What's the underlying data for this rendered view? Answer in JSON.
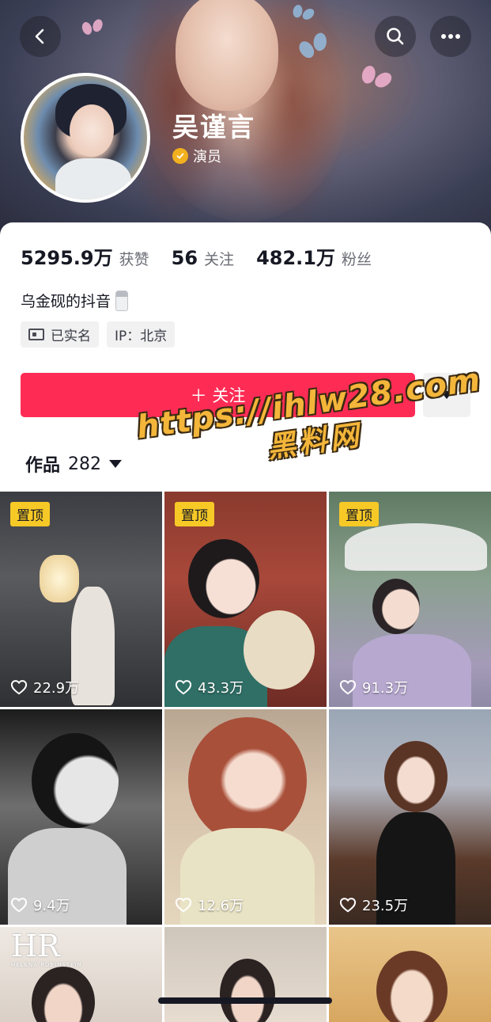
{
  "profile": {
    "name": "吴谨言",
    "role": "演员",
    "bio": "乌金砚的抖音",
    "tags": [
      "已实名",
      "IP：北京"
    ]
  },
  "stats": [
    {
      "value": "5295.9万",
      "label": "获赞"
    },
    {
      "value": "56",
      "label": "关注"
    },
    {
      "value": "482.1万",
      "label": "粉丝"
    }
  ],
  "actions": {
    "follow_label": "＋ 关注"
  },
  "works": {
    "label": "作品",
    "count": "282"
  },
  "watermark": {
    "url": "https://ihlw28.com",
    "name": "黑料网"
  },
  "videos": [
    {
      "pinned": "置顶",
      "likes": "22.9万"
    },
    {
      "pinned": "置顶",
      "likes": "43.3万"
    },
    {
      "pinned": "置顶",
      "likes": "91.3万"
    },
    {
      "pinned": "",
      "likes": "9.4万"
    },
    {
      "pinned": "",
      "likes": "12.6万"
    },
    {
      "pinned": "",
      "likes": "23.5万"
    }
  ],
  "partial_tile": {
    "logo": "HR",
    "logo_sub": "HELENA RUBINSTEIN"
  },
  "icons": [
    "back-icon",
    "search-icon",
    "more-icon",
    "verified-icon",
    "id-card-icon",
    "dropdown-icon",
    "heart-icon"
  ],
  "colors": {
    "accent": "#fe2c55",
    "pin": "#f7c926",
    "verified": "#f2b01e"
  }
}
